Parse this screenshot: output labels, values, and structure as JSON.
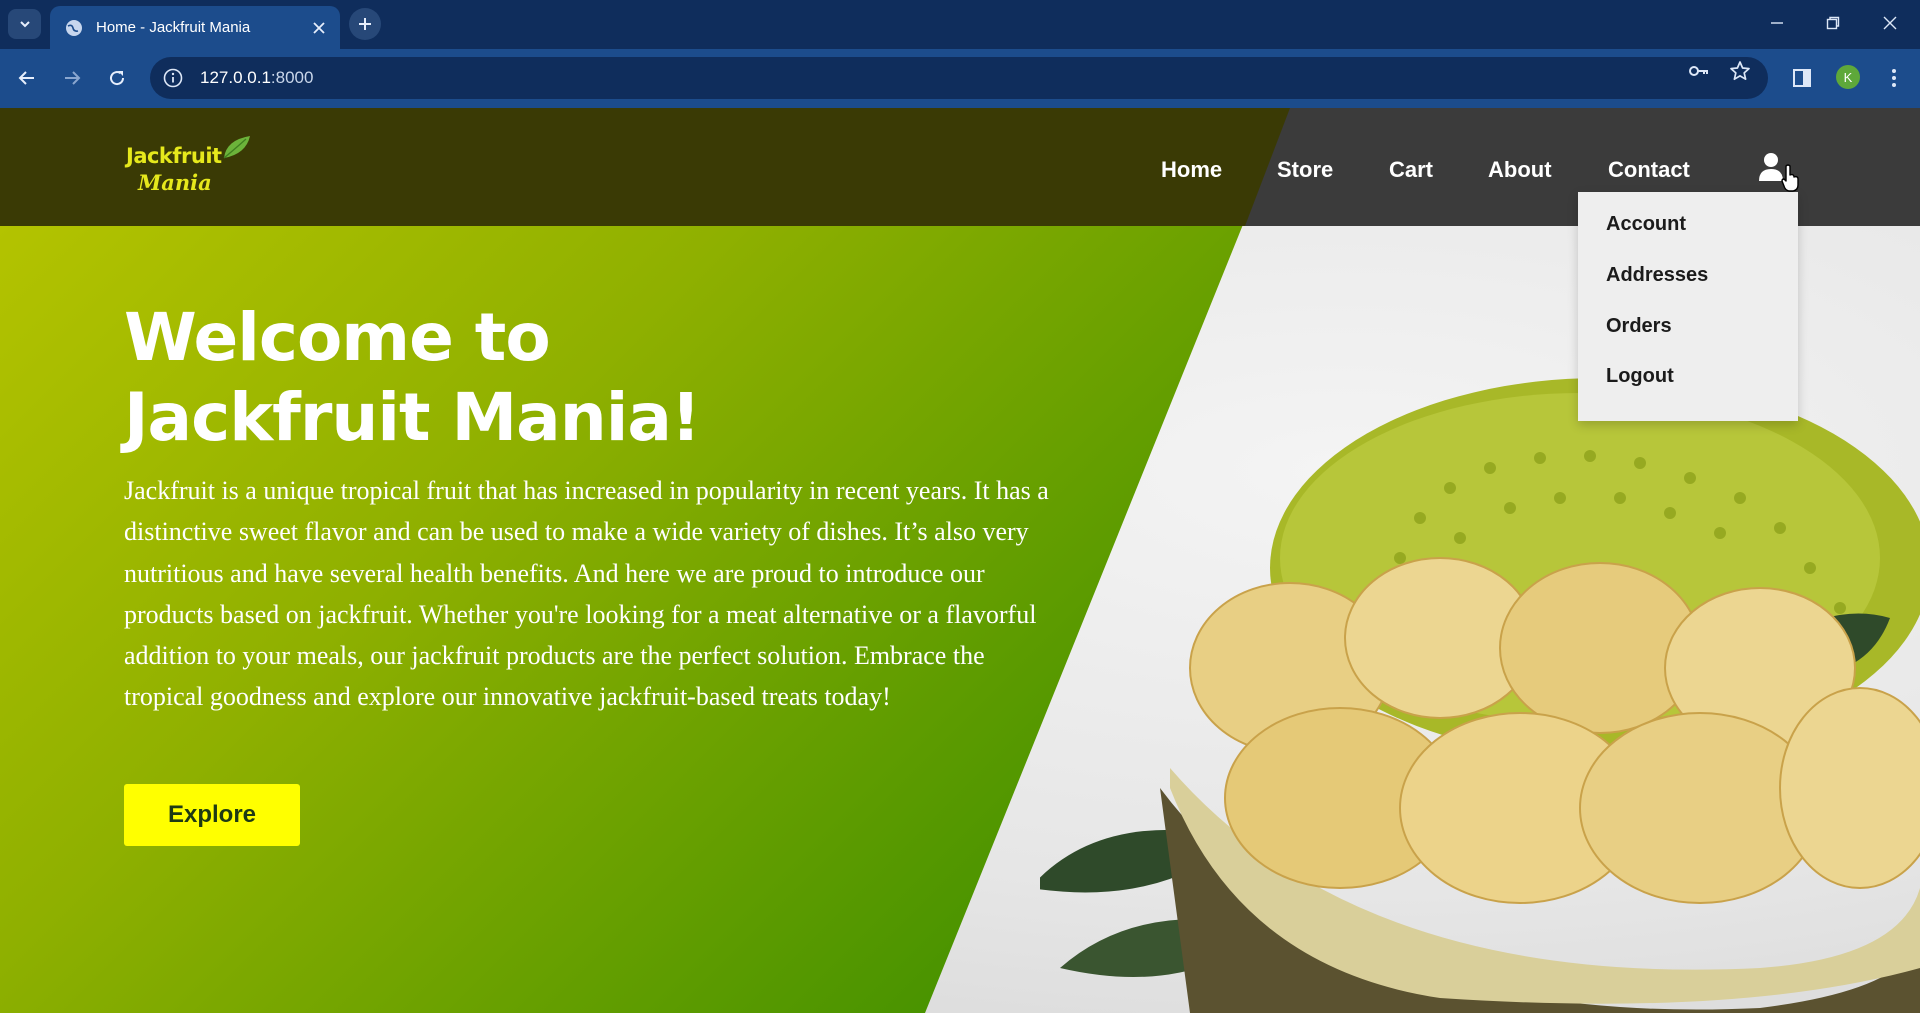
{
  "browser": {
    "tab_title": "Home - Jackfruit Mania",
    "url_host": "127.0.0.1",
    "url_port": ":8000",
    "profile_initial": "K"
  },
  "site": {
    "logo_line1": "Jackfruit",
    "logo_line2": "Mania",
    "nav": [
      "Home",
      "Store",
      "Cart",
      "About",
      "Contact"
    ],
    "user_menu": [
      "Account",
      "Addresses",
      "Orders",
      "Logout"
    ],
    "hero": {
      "title_line1": "Welcome to",
      "title_line2": "Jackfruit Mania!",
      "description": "Jackfruit is a unique tropical fruit that has increased in popularity in recent years. It has a distinctive sweet flavor and can be used to make a wide variety of dishes. It’s also very nutritious and have several health benefits. And here we are proud to introduce our products based on jackfruit. Whether you're looking for a meat alternative or a flavorful addition to your meals, our jackfruit products are the perfect solution. Embrace the tropical goodness and explore our innovative jackfruit-based treats today!",
      "cta": "Explore"
    }
  },
  "colors": {
    "chrome_dark": "#0f2d5c",
    "chrome_toolbar": "#1c4c8c",
    "header_gray": "#3b3b3b",
    "logo_yellow": "#e6e81c",
    "cta_yellow": "#ffff00"
  },
  "icons": [
    "tab-list-icon",
    "globe-icon",
    "close-icon",
    "plus-icon",
    "minimize-icon",
    "restore-icon",
    "back-icon",
    "forward-icon",
    "reload-icon",
    "info-icon",
    "key-icon",
    "star-icon",
    "sidebar-icon",
    "kebab-menu-icon",
    "user-icon",
    "leaf-icon",
    "pointer-cursor-icon"
  ]
}
